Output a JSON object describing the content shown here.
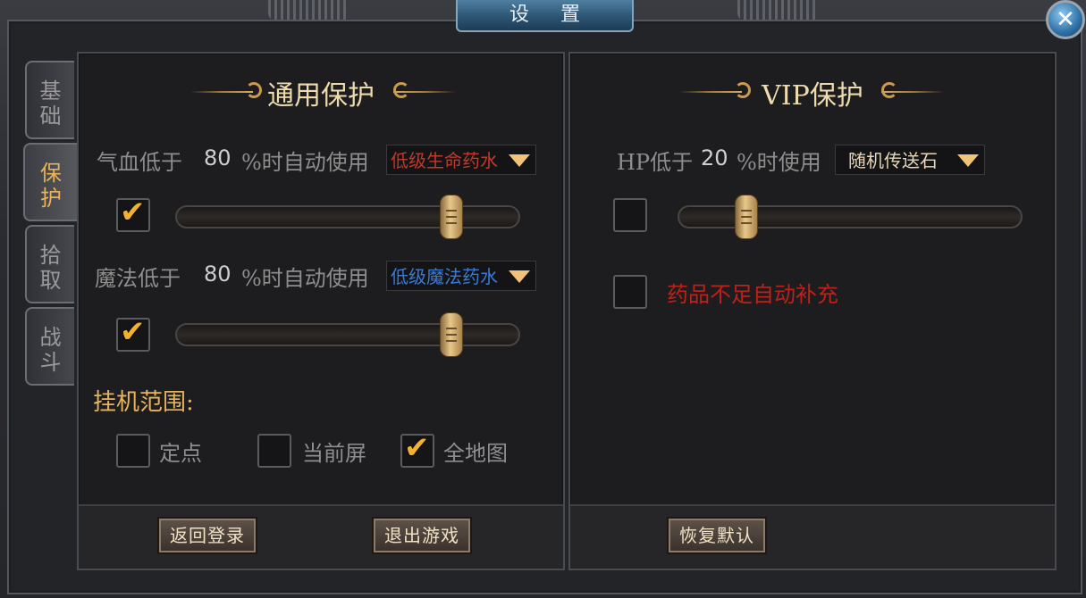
{
  "window": {
    "title": "设 置",
    "close_label": "✕"
  },
  "tabs": [
    {
      "label": "基础",
      "active": false
    },
    {
      "label": "保护",
      "active": true
    },
    {
      "label": "拾取",
      "active": false
    },
    {
      "label": "战斗",
      "active": false
    }
  ],
  "general": {
    "title": "通用保护",
    "hp": {
      "label_pre": "气血低于",
      "value": "80",
      "label_post": "%时自动使用",
      "item": "低级生命药水",
      "item_color": "#c0392b",
      "checked": true,
      "slider_level": 0.8
    },
    "mp": {
      "label_pre": "魔法低于",
      "value": "80",
      "label_post": "%时自动使用",
      "item": "低级魔法药水",
      "item_color": "#3a7bd5",
      "checked": true,
      "slider_level": 0.8
    },
    "range_title": "挂机范围:",
    "range_options": [
      {
        "label": "定点",
        "checked": false
      },
      {
        "label": "当前屏",
        "checked": false
      },
      {
        "label": "全地图",
        "checked": true
      }
    ],
    "buttons": {
      "back_login": "返回登录",
      "exit_game": "退出游戏"
    }
  },
  "vip": {
    "title": "VIP保护",
    "hp": {
      "label_pre": "HP低于",
      "value": "20",
      "label_post": "%时使用",
      "item": "随机传送石",
      "item_color": "#e8d8b8",
      "checked": false,
      "slider_level": 0.2
    },
    "refill": {
      "label": "药品不足自动补充",
      "color": "#c0201a",
      "checked": false
    },
    "buttons": {
      "restore_default": "恢复默认"
    }
  },
  "colors": {
    "accent_gold": "#e8b35a",
    "title_text": "#eedcae"
  }
}
